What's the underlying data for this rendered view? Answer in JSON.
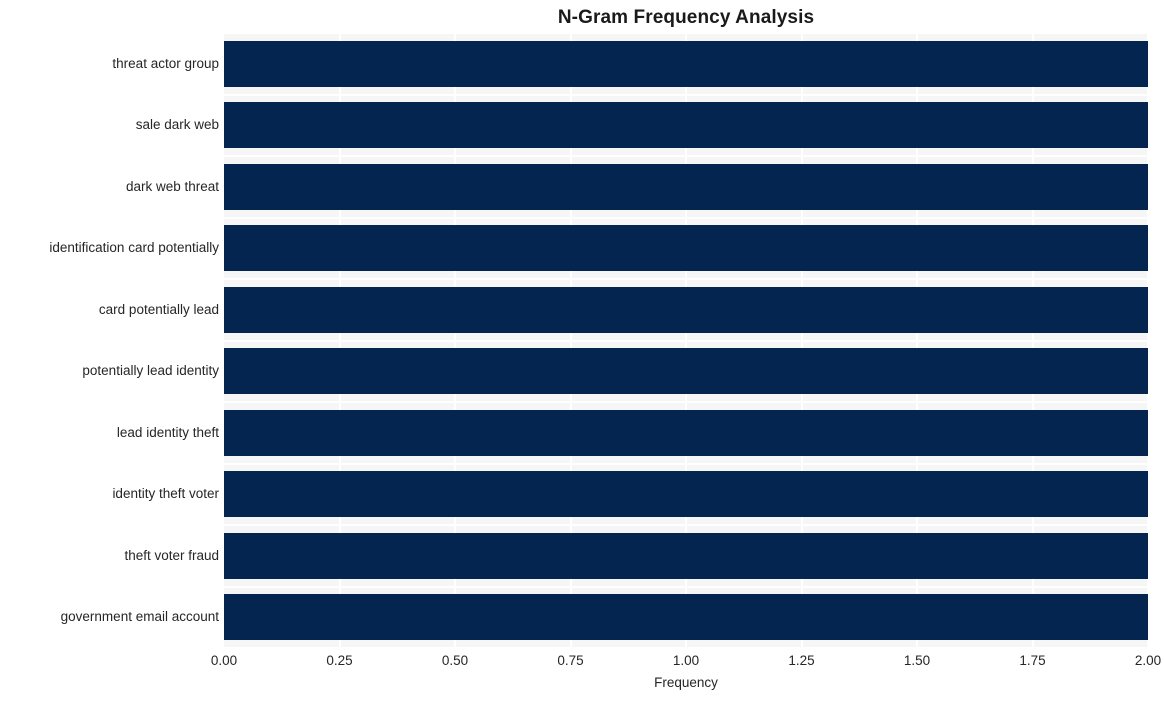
{
  "chart_data": {
    "type": "bar",
    "orientation": "horizontal",
    "title": "N-Gram Frequency Analysis",
    "xlabel": "Frequency",
    "ylabel": "",
    "xlim": [
      0.0,
      2.0
    ],
    "xticks": [
      "0.00",
      "0.25",
      "0.50",
      "0.75",
      "1.00",
      "1.25",
      "1.50",
      "1.75",
      "2.00"
    ],
    "xtick_values": [
      0.0,
      0.25,
      0.5,
      0.75,
      1.0,
      1.25,
      1.5,
      1.75,
      2.0
    ],
    "grid": true,
    "grid_color": "#ffffff",
    "plot_background": "#f6f6f7",
    "bar_color": "#04254f",
    "legend": null,
    "categories": [
      "threat actor group",
      "sale dark web",
      "dark web threat",
      "identification card potentially",
      "card potentially lead",
      "potentially lead identity",
      "lead identity theft",
      "identity theft voter",
      "theft voter fraud",
      "government email account"
    ],
    "values": [
      2,
      2,
      2,
      2,
      2,
      2,
      2,
      2,
      2,
      2
    ]
  }
}
